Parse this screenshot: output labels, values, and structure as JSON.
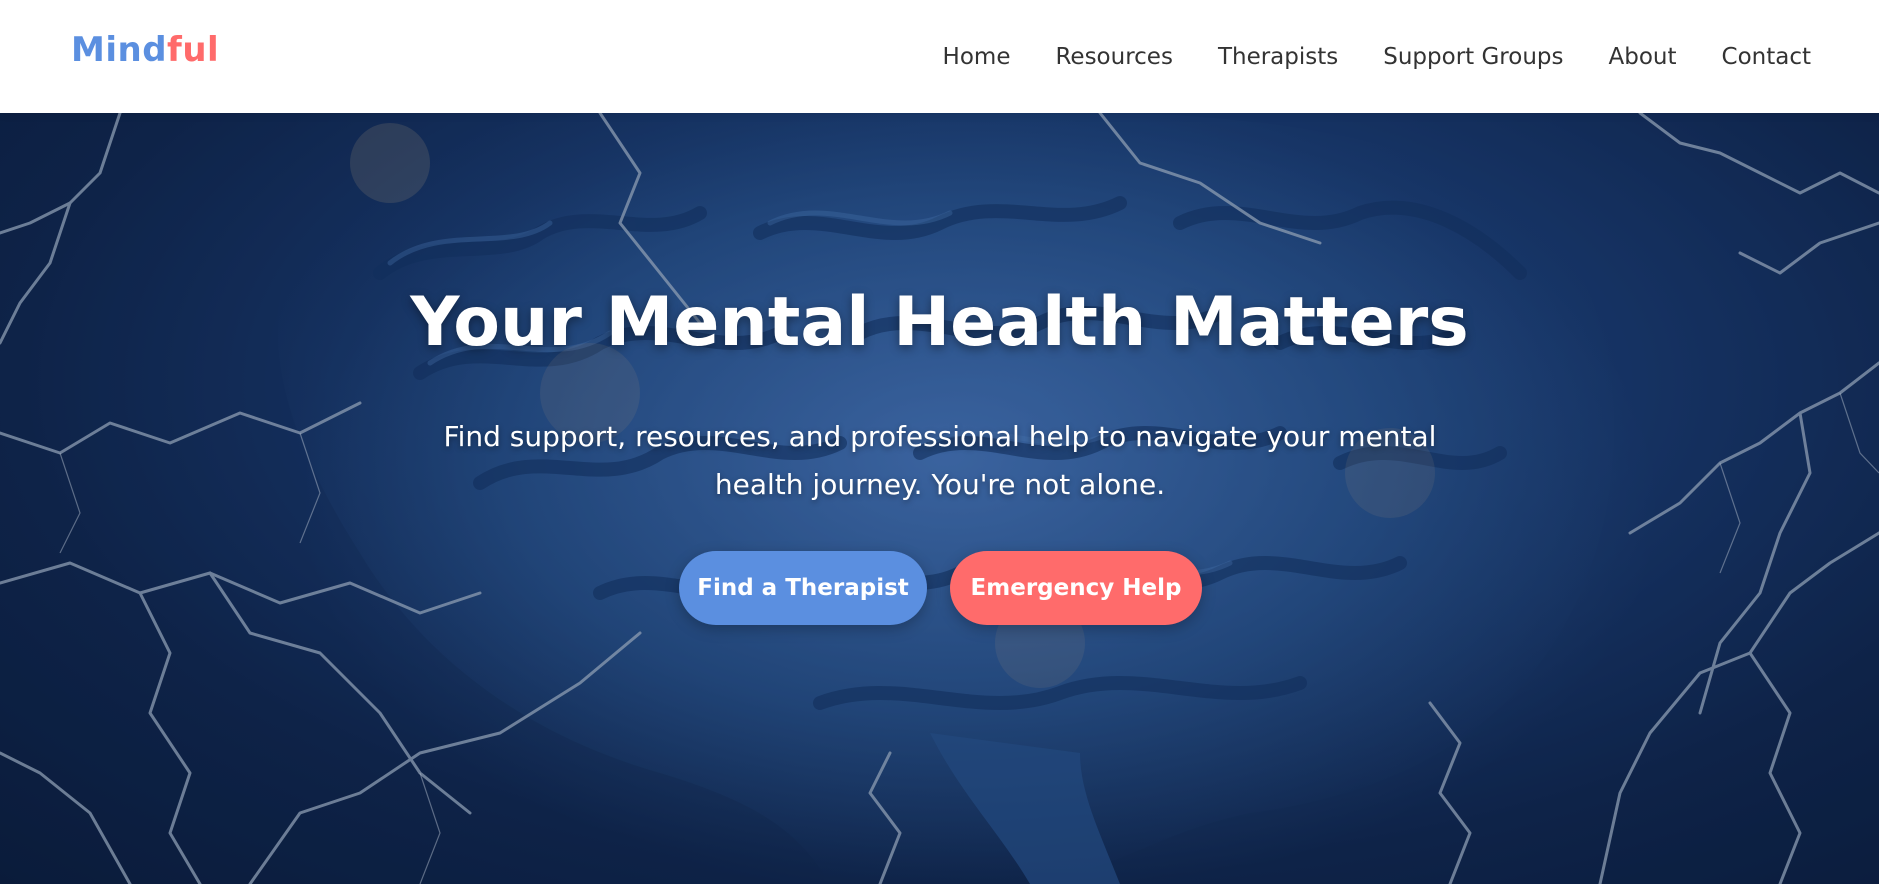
{
  "brand": {
    "part1": "Mind",
    "part2": "ful",
    "color1": "#5b8fe0",
    "color2": "#ff6b6b"
  },
  "nav": {
    "items": [
      {
        "label": "Home"
      },
      {
        "label": "Resources"
      },
      {
        "label": "Therapists"
      },
      {
        "label": "Support Groups"
      },
      {
        "label": "About"
      },
      {
        "label": "Contact"
      }
    ]
  },
  "hero": {
    "title": "Your Mental Health Matters",
    "subtitle": "Find support, resources, and professional help to navigate your mental health journey. You're not alone.",
    "primary_button": "Find a Therapist",
    "secondary_button": "Emergency Help",
    "background_image": "brain-with-lightning"
  },
  "colors": {
    "primary": "#5b8fe0",
    "danger": "#ff6b6b",
    "text": "#333333"
  }
}
